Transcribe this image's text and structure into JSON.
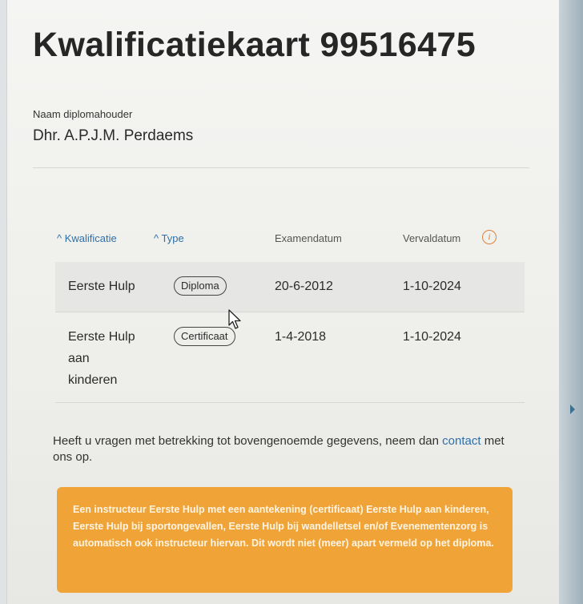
{
  "title": "Kwalificatiekaart 99516475",
  "holder": {
    "label": "Naam diplomahouder",
    "name": "Dhr. A.P.J.M. Perdaems"
  },
  "table": {
    "headers": {
      "qualification": "Kwalificatie",
      "type": "Type",
      "exam_date": "Examendatum",
      "expiry_date": "Vervaldatum"
    },
    "sort_indicator": "^",
    "info_icon_glyph": "i",
    "rows": [
      {
        "qualification_lines": [
          "Eerste Hulp"
        ],
        "type": "Diploma",
        "exam_date": "20-6-2012",
        "expiry_date": "1-10-2024"
      },
      {
        "qualification_lines": [
          "Eerste Hulp",
          "aan",
          "kinderen"
        ],
        "type": "Certificaat",
        "exam_date": "1-4-2018",
        "expiry_date": "1-10-2024"
      }
    ]
  },
  "contact_note": {
    "before": "Heeft u vragen met betrekking tot bovengenoemde gegevens, neem dan ",
    "link": "contact",
    "after": " met ons op."
  },
  "banner_text": "Een instructeur Eerste Hulp met een aantekening (certificaat) Eerste Hulp aan kinderen, Eerste Hulp bij sportongevallen, Eerste Hulp bij wandelletsel en/of Evenementenzorg is automatisch ook instructeur hiervan. Dit wordt niet (meer) apart vermeld op het diploma.",
  "colors": {
    "accent_link": "#2f6fa8",
    "banner_bg": "#f0a437",
    "info_icon": "#e0813c"
  },
  "icons": {
    "info": "info-icon",
    "cursor": "mouse-pointer-icon",
    "sort": "sort-ascending-icon"
  }
}
